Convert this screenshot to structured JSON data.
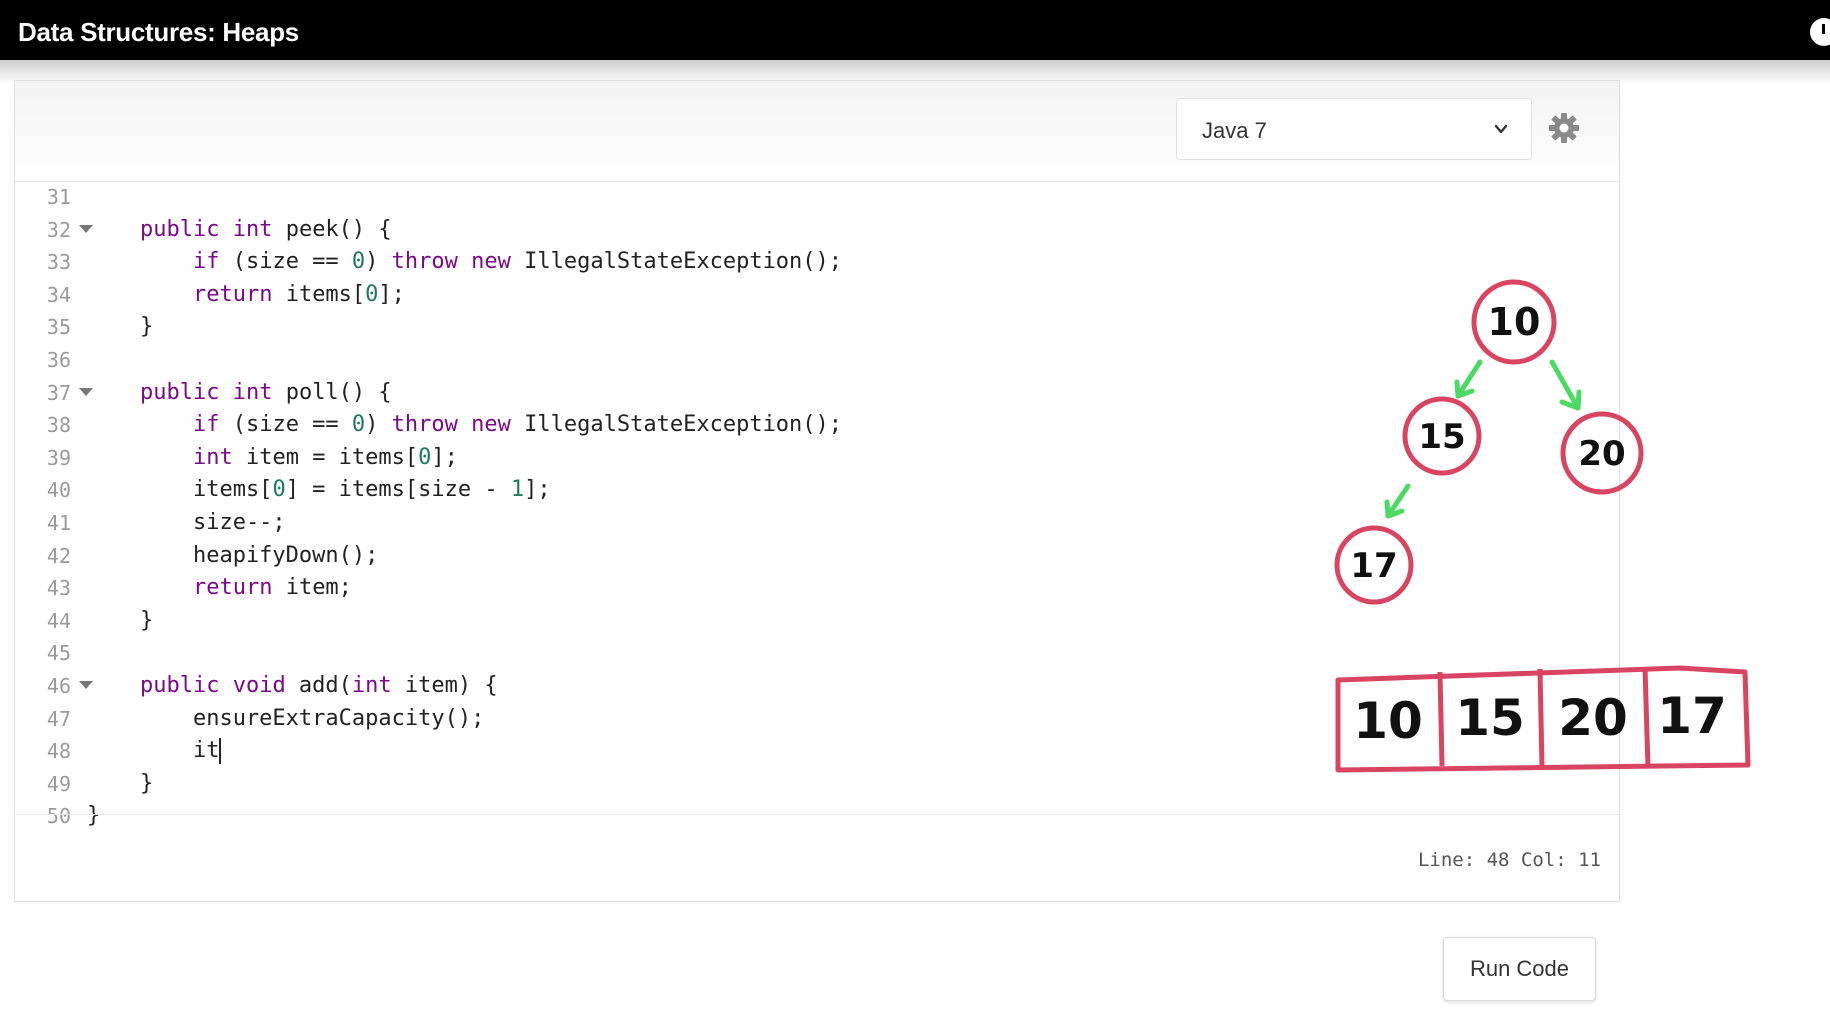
{
  "window": {
    "title": "Data Structures: Heaps"
  },
  "toolbar": {
    "language": "Java 7",
    "icons": {
      "dropdown": "chevron-down-icon",
      "settings": "gear-icon"
    }
  },
  "code": {
    "lines": [
      {
        "num": "31",
        "fold": false,
        "tokens": []
      },
      {
        "num": "32",
        "fold": true,
        "tokens": [
          [
            "kw",
            "    public"
          ],
          [
            "t",
            " "
          ],
          [
            "kw",
            "int"
          ],
          [
            "t",
            " peek() {"
          ]
        ]
      },
      {
        "num": "33",
        "fold": false,
        "tokens": [
          [
            "t",
            "        "
          ],
          [
            "kw",
            "if"
          ],
          [
            "t",
            " (size == "
          ],
          [
            "num",
            "0"
          ],
          [
            "t",
            ") "
          ],
          [
            "kw",
            "throw"
          ],
          [
            "t",
            " "
          ],
          [
            "kw",
            "new"
          ],
          [
            "t",
            " IllegalStateException();"
          ]
        ]
      },
      {
        "num": "34",
        "fold": false,
        "tokens": [
          [
            "t",
            "        "
          ],
          [
            "kw",
            "return"
          ],
          [
            "t",
            " items["
          ],
          [
            "num",
            "0"
          ],
          [
            "t",
            "];"
          ]
        ]
      },
      {
        "num": "35",
        "fold": false,
        "tokens": [
          [
            "t",
            "    }"
          ]
        ]
      },
      {
        "num": "36",
        "fold": false,
        "tokens": []
      },
      {
        "num": "37",
        "fold": true,
        "tokens": [
          [
            "kw",
            "    public"
          ],
          [
            "t",
            " "
          ],
          [
            "kw",
            "int"
          ],
          [
            "t",
            " poll() {"
          ]
        ]
      },
      {
        "num": "38",
        "fold": false,
        "tokens": [
          [
            "t",
            "        "
          ],
          [
            "kw",
            "if"
          ],
          [
            "t",
            " (size == "
          ],
          [
            "num",
            "0"
          ],
          [
            "t",
            ") "
          ],
          [
            "kw",
            "throw"
          ],
          [
            "t",
            " "
          ],
          [
            "kw",
            "new"
          ],
          [
            "t",
            " IllegalStateException();"
          ]
        ]
      },
      {
        "num": "39",
        "fold": false,
        "tokens": [
          [
            "t",
            "        "
          ],
          [
            "kw",
            "int"
          ],
          [
            "t",
            " item = items["
          ],
          [
            "num",
            "0"
          ],
          [
            "t",
            "];"
          ]
        ]
      },
      {
        "num": "40",
        "fold": false,
        "tokens": [
          [
            "t",
            "        items["
          ],
          [
            "num",
            "0"
          ],
          [
            "t",
            "] = items[size - "
          ],
          [
            "num",
            "1"
          ],
          [
            "t",
            "];"
          ]
        ]
      },
      {
        "num": "41",
        "fold": false,
        "tokens": [
          [
            "t",
            "        size--;"
          ]
        ]
      },
      {
        "num": "42",
        "fold": false,
        "tokens": [
          [
            "t",
            "        heapifyDown();"
          ]
        ]
      },
      {
        "num": "43",
        "fold": false,
        "tokens": [
          [
            "t",
            "        "
          ],
          [
            "kw",
            "return"
          ],
          [
            "t",
            " item;"
          ]
        ]
      },
      {
        "num": "44",
        "fold": false,
        "tokens": [
          [
            "t",
            "    }"
          ]
        ]
      },
      {
        "num": "45",
        "fold": false,
        "tokens": []
      },
      {
        "num": "46",
        "fold": true,
        "tokens": [
          [
            "kw",
            "    public"
          ],
          [
            "t",
            " "
          ],
          [
            "kw",
            "void"
          ],
          [
            "t",
            " add("
          ],
          [
            "kw",
            "int"
          ],
          [
            "t",
            " item) {"
          ]
        ]
      },
      {
        "num": "47",
        "fold": false,
        "tokens": [
          [
            "t",
            "        ensureExtraCapacity();"
          ]
        ]
      },
      {
        "num": "48",
        "fold": false,
        "cursor": true,
        "tokens": [
          [
            "t",
            "        it"
          ]
        ]
      },
      {
        "num": "49",
        "fold": false,
        "tokens": [
          [
            "t",
            "    }"
          ]
        ]
      },
      {
        "num": "50",
        "fold": false,
        "tokens": [
          [
            "t",
            "}"
          ]
        ]
      }
    ]
  },
  "status": {
    "position": "Line: 48 Col: 11"
  },
  "actions": {
    "run_label": "Run Code"
  },
  "drawing": {
    "tree_nodes": [
      "10",
      "15",
      "20",
      "17"
    ],
    "array_cells": [
      "10",
      "15",
      "20",
      "17"
    ],
    "colors": {
      "circle": "#d94560",
      "arrow": "#4cd964",
      "ink": "#111111"
    }
  }
}
